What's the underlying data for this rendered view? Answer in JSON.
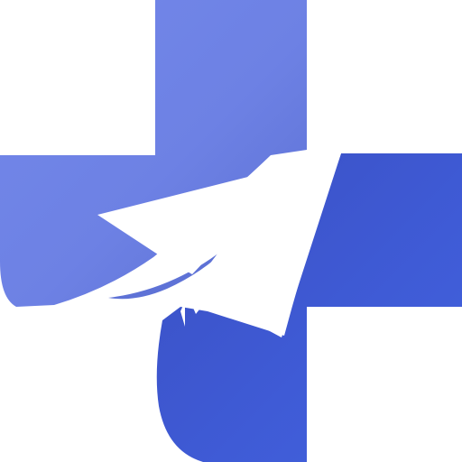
{
  "logo": {
    "icon": "medical-cross-paper-plane-icon",
    "colors": {
      "background": "#ffffff",
      "cross_light_start": "#6f84e8",
      "cross_light_end": "#6a7fdc",
      "cross_dark_start": "#3d52c4",
      "cross_dark_end": "#4161dc",
      "plane": "#ffffff"
    }
  }
}
